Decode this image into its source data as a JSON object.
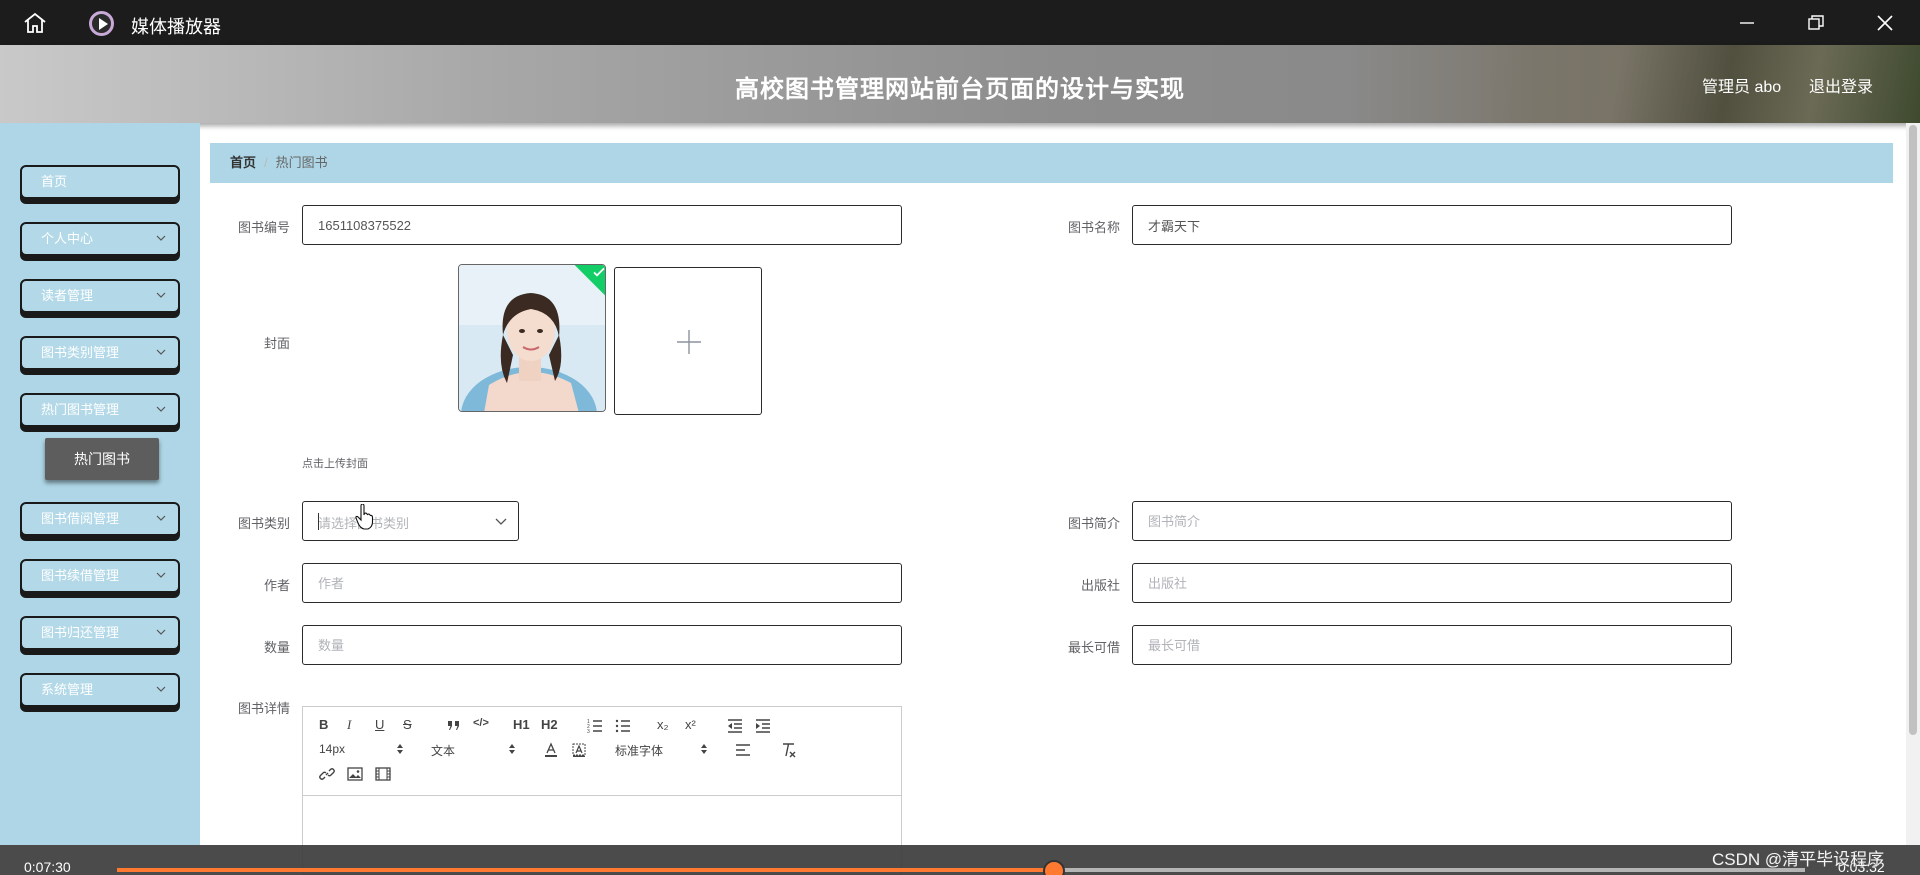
{
  "titlebar": {
    "app_title": "媒体播放器",
    "icons": [
      "home-icon",
      "media-player-logo-icon",
      "minimize-icon",
      "restore-icon",
      "close-icon"
    ]
  },
  "header": {
    "site_title": "高校图书管理网站前台页面的设计与实现",
    "admin_label": "管理员 abo",
    "logout_label": "退出登录"
  },
  "sidebar": {
    "items": [
      {
        "label": "首页"
      },
      {
        "label": "个人中心"
      },
      {
        "label": "读者管理"
      },
      {
        "label": "图书类别管理"
      },
      {
        "label": "热门图书管理"
      },
      {
        "label": "图书借阅管理"
      },
      {
        "label": "图书续借管理"
      },
      {
        "label": "图书归还管理"
      },
      {
        "label": "系统管理"
      }
    ],
    "active_submenu": "热门图书"
  },
  "breadcrumb": {
    "home": "首页",
    "separator": "/",
    "current": "热门图书"
  },
  "form": {
    "book_no": {
      "label": "图书编号",
      "value": "1651108375522"
    },
    "book_name": {
      "label": "图书名称",
      "value": "才霸天下"
    },
    "cover": {
      "label": "封面",
      "upload_tip": "点击上传封面"
    },
    "category": {
      "label": "图书类别",
      "placeholder": "请选择图书类别"
    },
    "intro": {
      "label": "图书简介",
      "placeholder": "图书简介"
    },
    "author": {
      "label": "作者",
      "placeholder": "作者"
    },
    "publisher": {
      "label": "出版社",
      "placeholder": "出版社"
    },
    "quantity": {
      "label": "数量",
      "placeholder": "数量"
    },
    "max_borrow": {
      "label": "最长可借",
      "placeholder": "最长可借"
    },
    "detail": {
      "label": "图书详情"
    }
  },
  "editor": {
    "toolbar_row1": {
      "bold": "B",
      "italic": "I",
      "underline": "U",
      "strike": "S",
      "code": "</>",
      "h1": "H1",
      "h2": "H2",
      "sub": "x₂",
      "sup": "x²"
    },
    "font_size": "14px",
    "header_style": "文本",
    "font_family": "标准字体"
  },
  "player": {
    "elapsed": "0:07:30",
    "total": "0:03:32",
    "progress": 0.555,
    "watermark": "CSDN @清平毕设程序"
  },
  "colors": {
    "sidebar_bg": "#aed6e6",
    "accent_orange": "#ff7a30",
    "success_green": "#13ce66"
  }
}
